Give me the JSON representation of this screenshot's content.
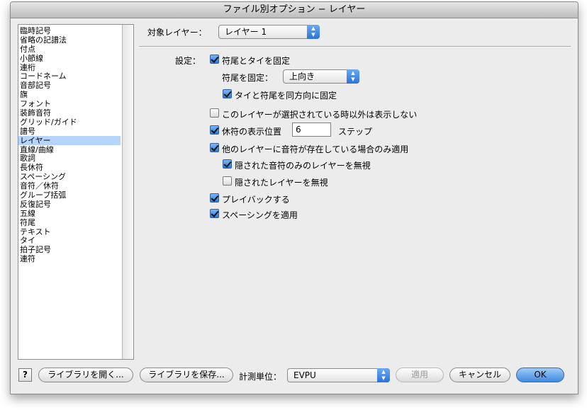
{
  "window": {
    "title": "ファイル別オプション − レイヤー"
  },
  "categories": {
    "selected_index": 13,
    "items": [
      "臨時記号",
      "省略の記譜法",
      "付点",
      "小節線",
      "連桁",
      "コードネーム",
      "音部記号",
      "旗",
      "フォント",
      "装飾音符",
      "グリッド/ガイド",
      "譜号",
      "レイヤー",
      "直線/曲線",
      "歌詞",
      "長休符",
      "スペーシング",
      "音符／休符",
      "グループ括弧",
      "反復記号",
      "五線",
      "符尾",
      "テキスト",
      "タイ",
      "拍子記号",
      "連符"
    ]
  },
  "target_layer": {
    "label": "対象レイヤー：",
    "value": "レイヤー 1"
  },
  "settings": {
    "label": "設定：",
    "fix_stem_and_tie": {
      "label": "符尾とタイを固定",
      "checked": true
    },
    "stem_fix": {
      "label": "符尾を固定：",
      "value": "上向き"
    },
    "tie_same_direction": {
      "label": "タイと符尾を同方向に固定",
      "checked": true
    },
    "hide_unselected": {
      "label": "このレイヤーが選択されている時以外は表示しない",
      "checked": false
    },
    "rest_position": {
      "label": "休符の表示位置",
      "value": "6",
      "unit": "ステップ",
      "checked": true
    },
    "only_when_other_layers": {
      "label": "他のレイヤーに音符が存在している場合のみ適用",
      "checked": true
    },
    "ignore_hidden_notes": {
      "label": "隠された音符のみのレイヤーを無視",
      "checked": true
    },
    "ignore_hidden_layers": {
      "label": "隠されたレイヤーを無視",
      "checked": false
    },
    "playback": {
      "label": "プレイバックする",
      "checked": true
    },
    "apply_spacing": {
      "label": "スペーシングを適用",
      "checked": true
    }
  },
  "footer": {
    "help": "?",
    "open_library": "ライブラリを開く...",
    "save_library": "ライブラリを保存...",
    "units_label": "計測単位：",
    "units_value": "EVPU",
    "apply": "適用",
    "cancel": "キャンセル",
    "ok": "OK"
  }
}
